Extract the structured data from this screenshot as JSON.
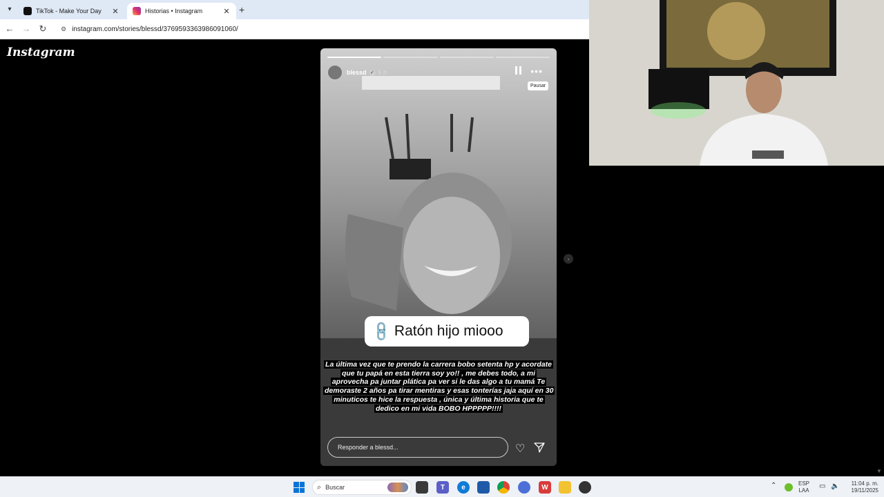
{
  "browser": {
    "tabs": [
      {
        "title": "TikTok - Make Your Day",
        "active": false,
        "favicon": "tiktok-icon"
      },
      {
        "title": "Historias • Instagram",
        "active": true,
        "favicon": "instagram-icon"
      }
    ],
    "url": "instagram.com/stories/blessd/3769593363986091060/"
  },
  "instagram": {
    "logo": "Instagram"
  },
  "story": {
    "username": "blessd",
    "time": "5 h",
    "progress": [
      1.0,
      0.0,
      0.0,
      0.0
    ],
    "tooltip": "Pausar",
    "link_sticker": "Ratón hijo miooo",
    "caption": "La última vez que te prendo la carrera bobo setenta hp y acordate que tu papá en esta tierra soy yo!! , me debes todo, a mi aprovecha pa juntar plática pa ver si le das algo a tu mamá  Te demoraste 2 años pa tirar mentiras y esas tonterías jaja aquí en 30 minuticos te hice la respuesta , única y última historia que te dedico en mi vida BOBO HPPPPP!!!!",
    "reply_placeholder": "Responder a blessd..."
  },
  "taskbar": {
    "search": "Buscar",
    "lang_top": "ESP",
    "lang_bottom": "LAA",
    "clock_time": "11:04 p. m.",
    "clock_date": "19/11/2025"
  },
  "colors": {
    "tab_bar": "#dfe8f5",
    "page_bg": "#000000",
    "link_blue": "#2a7be4",
    "taskbar_bg": "#eef1f6"
  }
}
